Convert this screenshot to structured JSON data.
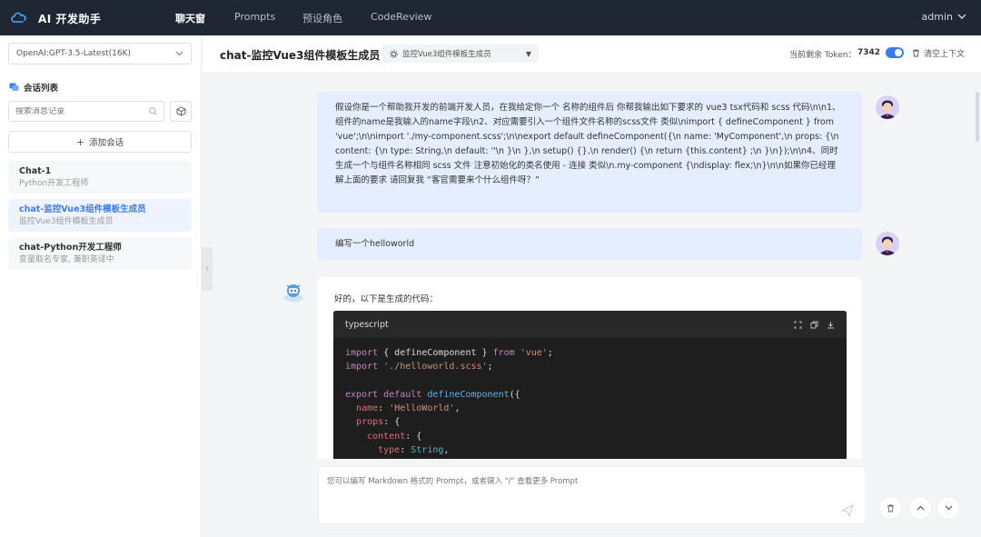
{
  "nav": {
    "brand": "AI 开发助手",
    "tabs": [
      {
        "label": "聊天窗"
      },
      {
        "label": "Prompts"
      },
      {
        "label": "预设角色"
      },
      {
        "label": "CodeReview"
      }
    ],
    "active_tab": "聊天窗",
    "user": "admin"
  },
  "sidebar": {
    "model": "OpenAI:GPT-3.5-Latest(16K)",
    "section_title": "会话列表",
    "search_placeholder": "搜索消息记录",
    "add_label": "添加会话",
    "conversations": [
      {
        "title": "Chat-1",
        "subtitle": "Python开发工程师"
      },
      {
        "title": "chat-监控Vue3组件模板生成员",
        "subtitle": "监控Vue3组件模板生成员"
      },
      {
        "title": "chat-Python开发工程师",
        "subtitle": "变量取名专家, 兼职英译中"
      }
    ],
    "active_conversation": "chat-监控Vue3组件模板生成员"
  },
  "header": {
    "title": "chat-监控Vue3组件模板生成员",
    "role": "监控Vue3组件模板生成员",
    "token_label": "当前剩余 Token：",
    "token_value": "7342",
    "clear_label": "清空上下文"
  },
  "messages": {
    "user1": "假设你是一个帮助我开发的前端开发人员，在我给定你一个 名称的组件后 你帮我输出如下要求的 vue3 tsx代码和 scss 代码\\n\\n1、组件的name是我输入的name字段\\n2、对应需要引入一个组件文件名称的scss文件 类似\\nimport { defineComponent } from 'vue';\\n\\nimport './my-component.scss';\\n\\nexport default defineComponent({\\n name: 'MyComponent',\\n props: {\\n content: {\\n type: String,\\n default: ''\\n }\\n },\\n setup() {},\\n render() {\\n return {this.content}\n;\\n }\\n});\\n\\n4、同时生成一个与组件名称相同 scss 文件 注意初始化的类名使用 - 连接 类似\\n.my-component {\\ndisplay: flex;\\n}\\n\\n如果你已经理解上面的要求 请回复我 “客官需要来个什么组件呀？”",
    "user2": "编写一个helloworld",
    "bot_intro": "好的，以下是生成的代码：",
    "code_lang": "typescript"
  },
  "input": {
    "placeholder": "您可以编写 Markdown 格式的 Prompt，或者键入 \"/\" 查看更多 Prompt",
    "divider": "..."
  },
  "colors": {
    "nav_bg": "#1f2634",
    "accent": "#3b7cf2",
    "user_bubble": "#e4eefe",
    "code_bg": "#1e1e1e"
  }
}
